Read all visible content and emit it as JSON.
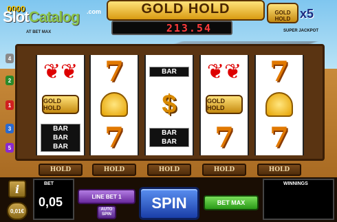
{
  "header": {
    "logo_slot": "Slot",
    "logo_catalog": "Catalog",
    "logo_com": ".com",
    "jackpot_partial": "0000",
    "bet_max_note": "AT BET MAX",
    "title": "GOLD HOLD",
    "jackpot_display": "213.54",
    "super_badge_text": "GOLD HOLD",
    "super_multiplier": "x5",
    "super_label": "SUPER JACKPOT"
  },
  "paylines": [
    "4",
    "2",
    "1",
    "3",
    "5"
  ],
  "payline_colors": [
    "#8a8a8a",
    "#2a8a2a",
    "#d02020",
    "#2a6ad0",
    "#8a2ad0"
  ],
  "reels": [
    [
      {
        "type": "cherry",
        "label": ""
      },
      {
        "type": "goldhold",
        "label": "GOLD HOLD"
      },
      {
        "type": "bar",
        "label": [
          "BAR",
          "BAR",
          "BAR"
        ]
      }
    ],
    [
      {
        "type": "seven",
        "label": "7"
      },
      {
        "type": "bell",
        "label": ""
      },
      {
        "type": "seven",
        "label": "7"
      }
    ],
    [
      {
        "type": "bar",
        "label": [
          "BAR"
        ]
      },
      {
        "type": "dollar",
        "label": "$"
      },
      {
        "type": "bar",
        "label": [
          "BAR",
          "BAR"
        ]
      }
    ],
    [
      {
        "type": "cherry",
        "label": ""
      },
      {
        "type": "goldhold",
        "label": "GOLD HOLD"
      },
      {
        "type": "seven",
        "label": "7"
      }
    ],
    [
      {
        "type": "seven",
        "label": "7"
      },
      {
        "type": "bell",
        "label": ""
      },
      {
        "type": "seven",
        "label": "7"
      }
    ]
  ],
  "hold_label": "HOLD",
  "controls": {
    "info_label": "i",
    "coin_label": "0,01€",
    "bet_title": "BET",
    "bet_value": "0,05",
    "line_bet_label": "LINE BET 1",
    "auto_spin_label": "AUTO SPIN",
    "spin_label": "SPIN",
    "bet_max_label": "BET MAX",
    "winnings_title": "WINNINGS"
  }
}
